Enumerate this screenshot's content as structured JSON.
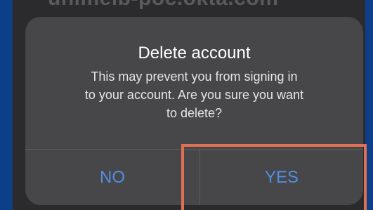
{
  "background_behind": {
    "text": "unimelb-poc.okta.com"
  },
  "dialog": {
    "title": "Delete account",
    "message_lines": [
      "This may prevent you from signing in",
      "to your account. Are you sure you want",
      "to delete?"
    ],
    "no_label": "NO",
    "yes_label": "YES"
  },
  "colors": {
    "page_background": "#0d3f88",
    "dialog_background": "#474749",
    "button_text": "#4f8fe4",
    "highlight_border": "#e06f54"
  }
}
